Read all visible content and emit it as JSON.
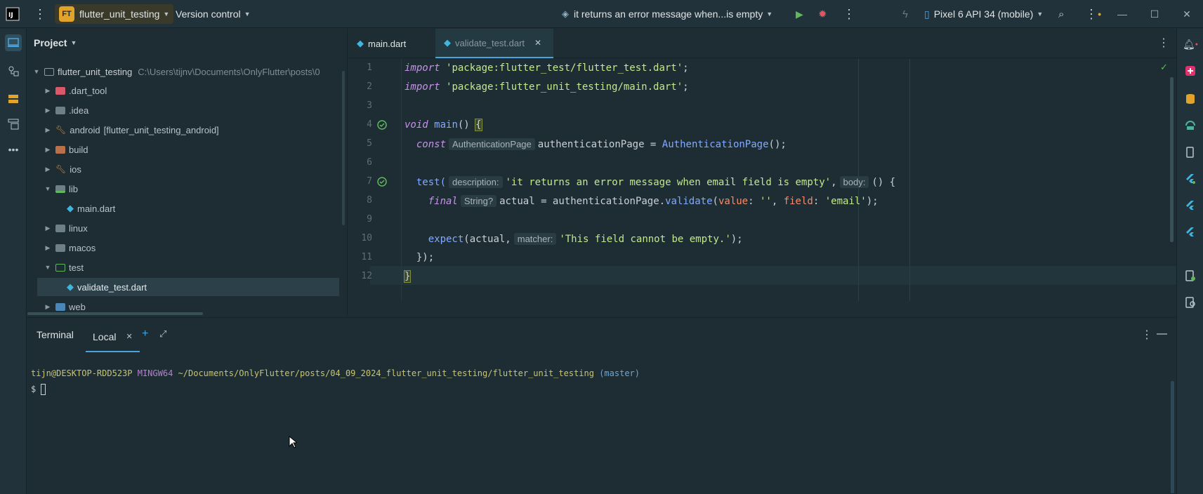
{
  "titlebar": {
    "project_badge": "FT",
    "project_name": "flutter_unit_testing",
    "vcs": "Version control",
    "run_config": "it returns an error message when...is empty",
    "device": "Pixel 6 API 34 (mobile)"
  },
  "project_panel": {
    "title": "Project",
    "root_name": "flutter_unit_testing",
    "root_path": "C:\\Users\\tijnv\\Documents\\OnlyFlutter\\posts\\0",
    "items": [
      {
        "label": ".dart_tool",
        "expanded": false,
        "kind": "folder-red"
      },
      {
        "label": ".idea",
        "expanded": false,
        "kind": "folder"
      },
      {
        "label": "android",
        "extra": "[flutter_unit_testing_android]",
        "expanded": false,
        "kind": "module"
      },
      {
        "label": "build",
        "expanded": false,
        "kind": "folder-orange"
      },
      {
        "label": "ios",
        "expanded": false,
        "kind": "module"
      },
      {
        "label": "lib",
        "expanded": true,
        "kind": "folder-green"
      },
      {
        "label": "main.dart",
        "kind": "dart-file"
      },
      {
        "label": "linux",
        "expanded": false,
        "kind": "folder"
      },
      {
        "label": "macos",
        "expanded": false,
        "kind": "folder"
      },
      {
        "label": "test",
        "expanded": true,
        "kind": "folder-test"
      },
      {
        "label": "validate_test.dart",
        "kind": "dart-file",
        "selected": true
      },
      {
        "label": "web",
        "expanded": false,
        "kind": "folder-blue"
      }
    ]
  },
  "editor": {
    "tabs": [
      {
        "label": "main.dart",
        "active": false
      },
      {
        "label": "validate_test.dart",
        "active": true
      }
    ],
    "line_numbers": [
      "1",
      "2",
      "3",
      "4",
      "5",
      "6",
      "7",
      "8",
      "9",
      "10",
      "11",
      "12"
    ],
    "code": {
      "l1_kw": "import",
      "l1_str": "'package:flutter_test/flutter_test.dart'",
      "l1_end": ";",
      "l2_kw": "import",
      "l2_str": "'package:flutter_unit_testing/main.dart'",
      "l2_end": ";",
      "l4_kw": "void",
      "l4_fn": "main",
      "l4_rest": "() ",
      "l4_brace": "{",
      "l5_kw": "const",
      "l5_hint": "AuthenticationPage",
      "l5_var": "authenticationPage = ",
      "l5_cls": "AuthenticationPage",
      "l5_end": "();",
      "l7_fn": "test(",
      "l7_hint": "description:",
      "l7_str": "'it returns an error message when email field is empty'",
      "l7_comma": ",",
      "l7_hint2": "body:",
      "l7_end": "() {",
      "l8_kw": "final",
      "l8_hint": "String?",
      "l8_var": "actual = authenticationPage.",
      "l8_fn": "validate",
      "l8_p1": "value",
      "l8_s1": "''",
      "l8_p2": "field",
      "l8_s2": "'email'",
      "l8_end": ");",
      "l10_fn": "expect",
      "l10_mid": "(actual,",
      "l10_hint": "matcher:",
      "l10_str": "'This field cannot be empty.'",
      "l10_end": ");",
      "l11": "});",
      "l12": "}"
    }
  },
  "terminal": {
    "title": "Terminal",
    "tab_local": "Local",
    "user_host": "tijn@DESKTOP-RDD523P",
    "shell": "MINGW64",
    "path": "~/Documents/OnlyFlutter/posts/04_09_2024_flutter_unit_testing/flutter_unit_testing",
    "branch": "(master)",
    "prompt": "$"
  },
  "colors": {
    "accent": "#4aa3df",
    "project_badge": "#e2a32a",
    "run_green": "#5fb85c",
    "debug_red": "#e05561"
  }
}
